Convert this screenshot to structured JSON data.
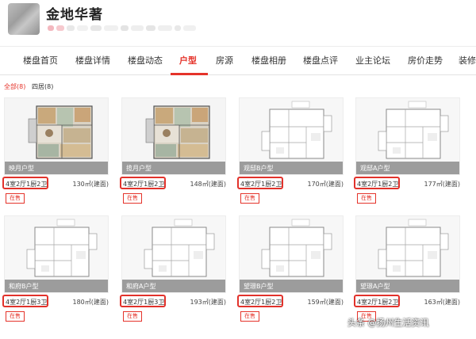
{
  "header": {
    "title": "金地华著"
  },
  "nav": {
    "items": [
      {
        "label": "楼盘首页",
        "active": false
      },
      {
        "label": "楼盘详情",
        "active": false
      },
      {
        "label": "楼盘动态",
        "active": false
      },
      {
        "label": "户型",
        "active": true
      },
      {
        "label": "房源",
        "active": false
      },
      {
        "label": "楼盘相册",
        "active": false
      },
      {
        "label": "楼盘点评",
        "active": false
      },
      {
        "label": "业主论坛",
        "active": false
      },
      {
        "label": "房价走势",
        "active": false
      },
      {
        "label": "装修",
        "active": false
      }
    ]
  },
  "filters": [
    {
      "label": "全部(8)",
      "active": true
    },
    {
      "label": "四居(8)",
      "active": false
    }
  ],
  "cards": [
    {
      "name": "映月户型",
      "spec": "4室2厅1厨2卫",
      "area": "130㎡(建面)",
      "status": "在售",
      "plan": "colored"
    },
    {
      "name": "揽月户型",
      "spec": "4室2厅1厨2卫",
      "area": "148㎡(建面)",
      "status": "在售",
      "plan": "colored"
    },
    {
      "name": "观邸B户型",
      "spec": "4室2厅1厨2卫",
      "area": "170㎡(建面)",
      "status": "在售",
      "plan": "line"
    },
    {
      "name": "观邸A户型",
      "spec": "4室2厅1厨2卫",
      "area": "177㎡(建面)",
      "status": "在售",
      "plan": "line"
    },
    {
      "name": "和府B户型",
      "spec": "4室2厅1厨3卫",
      "area": "180㎡(建面)",
      "status": "在售",
      "plan": "line"
    },
    {
      "name": "和府A户型",
      "spec": "4室2厅1厨3卫",
      "area": "193㎡(建面)",
      "status": "在售",
      "plan": "line"
    },
    {
      "name": "望璟B户型",
      "spec": "4室2厅1厨2卫",
      "area": "159㎡(建面)",
      "status": "在售",
      "plan": "line"
    },
    {
      "name": "望璟A户型",
      "spec": "4室2厅1厨2卫",
      "area": "163㎡(建面)",
      "status": "在售",
      "plan": "line"
    }
  ],
  "watermark": "头条 @扬州生活资讯",
  "colors": {
    "accent": "#e5332a",
    "spec_border": "#e2322b"
  }
}
